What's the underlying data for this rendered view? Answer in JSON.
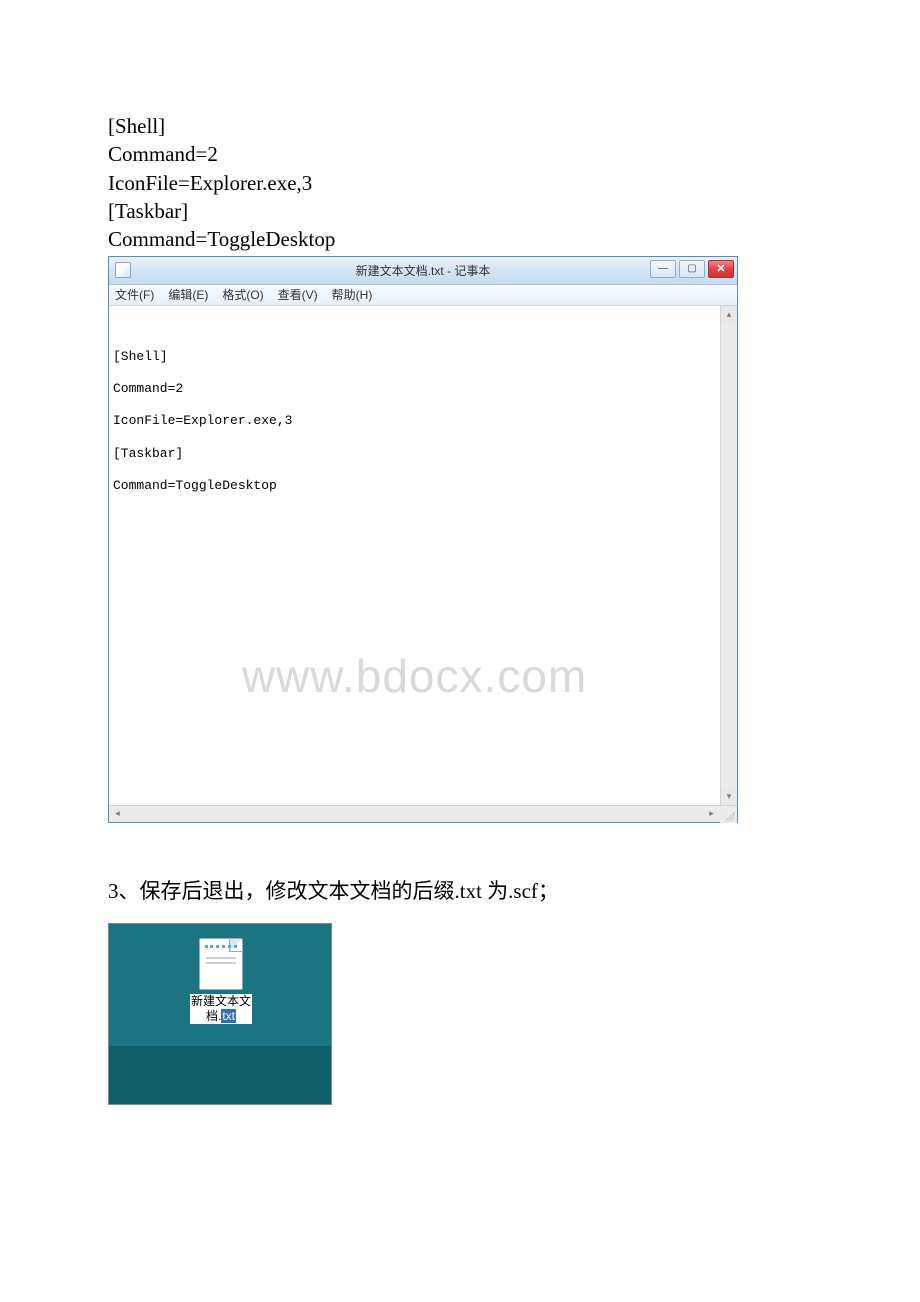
{
  "code_block": {
    "line1": "[Shell]",
    "line2": "Command=2",
    "line3": "IconFile=Explorer.exe,3",
    "line4": "[Taskbar]",
    "line5": "Command=ToggleDesktop"
  },
  "notepad": {
    "title": "新建文本文档.txt - 记事本",
    "menu": {
      "file": "文件(F)",
      "edit": "编辑(E)",
      "format": "格式(O)",
      "view": "查看(V)",
      "help": "帮助(H)"
    },
    "content": {
      "line1": "[Shell]",
      "line2": "Command=2",
      "line3": "IconFile=Explorer.exe,3",
      "line4": "[Taskbar]",
      "line5": "Command=ToggleDesktop"
    },
    "controls": {
      "minimize": "—",
      "maximize": "▢",
      "close": "✕"
    }
  },
  "watermark": "www.bdocx.com",
  "step3": "3、保存后退出，修改文本文档的后缀.txt 为.scf；",
  "desktop_icon": {
    "label_part1": "新建文本文",
    "label_part2_prefix": "档.",
    "label_part2_selected": "txt"
  }
}
